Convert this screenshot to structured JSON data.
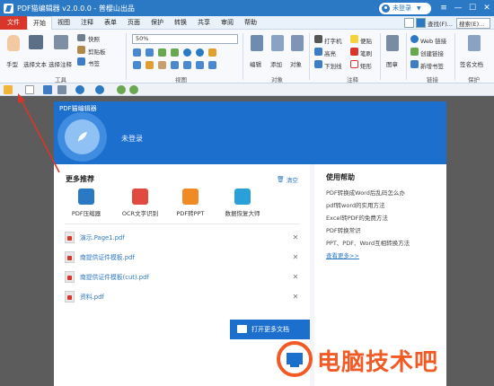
{
  "titlebar": {
    "title": "PDF猫编辑器 v2.0.0.0 - 普樱山出品",
    "user": "未登录"
  },
  "menubar": {
    "file": "文件",
    "items": [
      "开始",
      "视图",
      "注释",
      "表单",
      "页面",
      "保护",
      "转换",
      "共享",
      "审阅",
      "帮助"
    ],
    "find": "查找(F)...",
    "search": "搜索(E)..."
  },
  "ribbon": {
    "hand": "手型",
    "select_text": "选择文本",
    "select_annot": "选择注释",
    "snapshot": "快照",
    "clipboard": "剪贴板",
    "bookmark": "书签",
    "tools_group": "工具",
    "zoom": "50%",
    "view_group": "视图",
    "edit": "编辑",
    "add": "添加",
    "object": "对象",
    "objects_group": "对象",
    "typewriter": "打字机",
    "note": "便贴",
    "highlight": "高亮",
    "underline": "下划线",
    "rect": "矩形",
    "brush": "笔刷",
    "annot_group": "注释",
    "image": "图章",
    "web_link": "Web 链接",
    "create_link": "创建链接",
    "new_bookmark": "新增书签",
    "link_group": "链接",
    "sign": "签名文档",
    "protect_group": "保护"
  },
  "dialog": {
    "title": "PDF猫编辑器",
    "not_logged_in": "未登录",
    "recommend_title": "更多推荐",
    "clear": "清空",
    "tools": [
      {
        "label": "PDF压缩器",
        "color": "#2b78c5"
      },
      {
        "label": "OCR文字识别",
        "color": "#e04a3f"
      },
      {
        "label": "PDF转PPT",
        "color": "#f08a24"
      },
      {
        "label": "数据恢复大师",
        "color": "#2aa0d8"
      }
    ],
    "files": [
      "演示.Page1.pdf",
      "南提供证件模板.pdf",
      "南提供证件模板(cut).pdf",
      "资料.pdf"
    ],
    "open_more": "打开更多文档",
    "help_title": "使用帮助",
    "help_links": [
      "PDF转换成Word后乱码怎么办",
      "pdf转word的实用方法",
      "Excel转PDF的免费方法",
      "PDF转换常识",
      "PPT、PDF、Word互相转换方法"
    ],
    "see_more": "查看更多>>"
  },
  "watermark": {
    "text": "电脑技术吧"
  },
  "colors": {
    "title_bar": "#2b78c5",
    "dialog_header": "#1d6fce",
    "file_tab": "#d9352b",
    "watermark": "#f15a24"
  }
}
